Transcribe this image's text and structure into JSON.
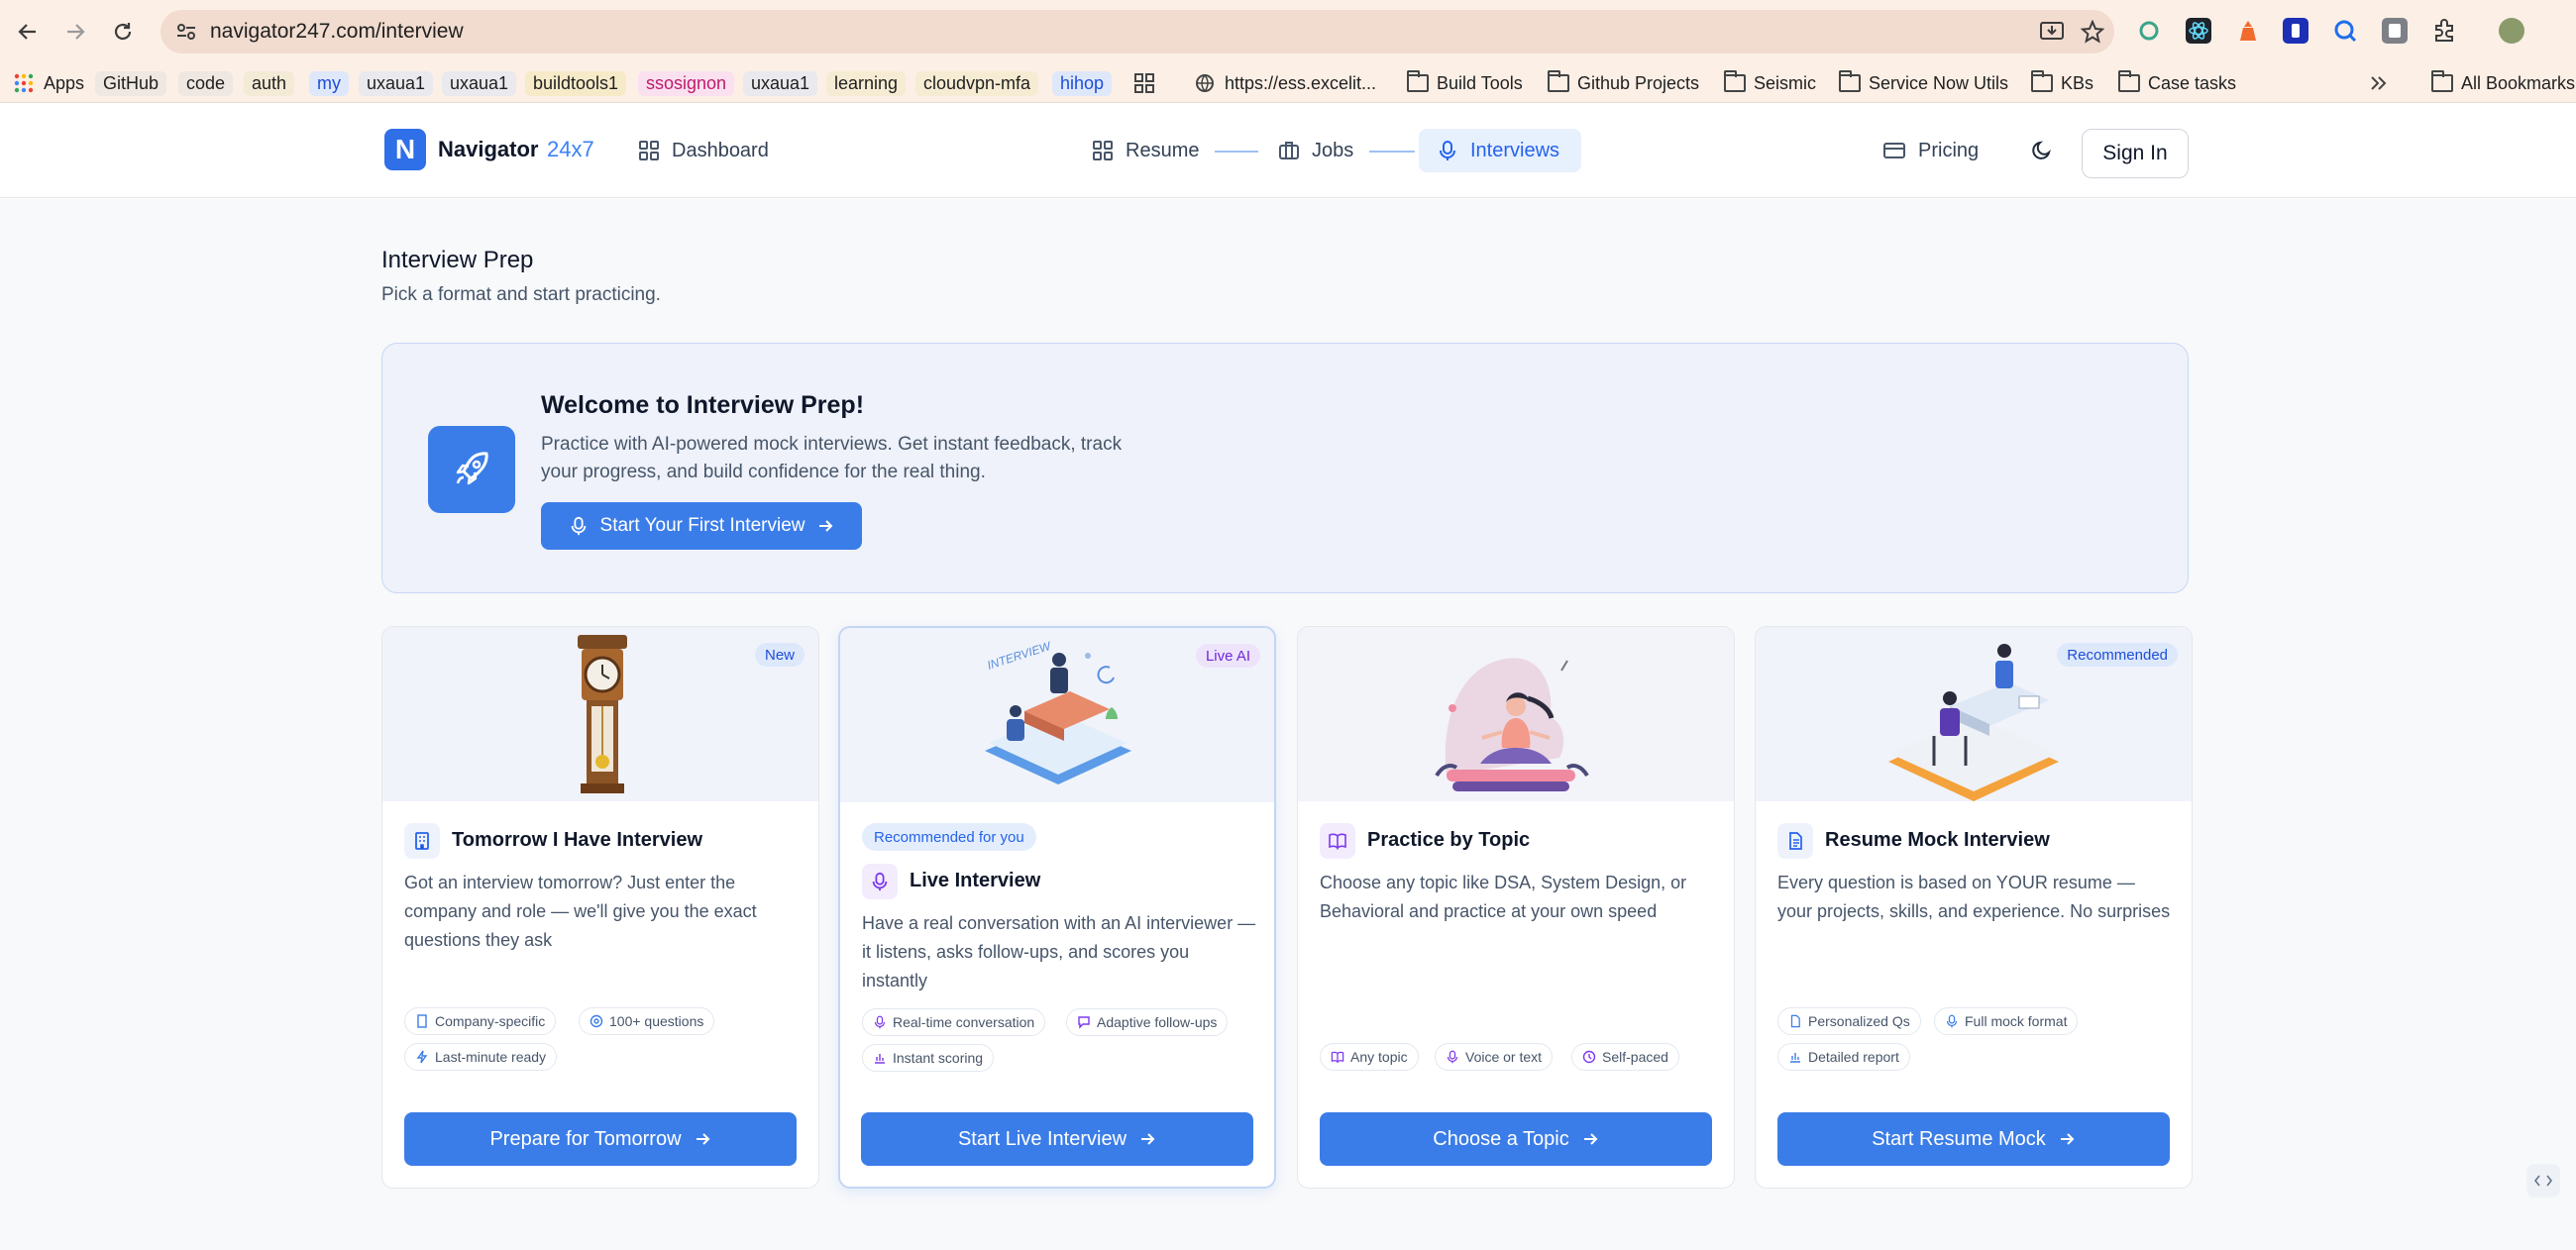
{
  "browser": {
    "url": "navigator247.com/interview",
    "bookmarks": [
      "Apps",
      "GitHub",
      "code",
      "auth",
      "my",
      "uxaua1",
      "uxaua1",
      "buildtools1",
      "ssosignon",
      "uxaua1",
      "learning",
      "cloudvpn-mfa",
      "hihop",
      "https://ess.excelit...",
      "Build Tools",
      "Github Projects",
      "Seismic",
      "Service Now Utils",
      "KBs",
      "Case tasks",
      "All Bookmarks"
    ]
  },
  "header": {
    "logo_letter": "N",
    "logo_name": "Navigator",
    "logo_suffix": "24x7",
    "nav": {
      "dashboard": "Dashboard",
      "resume": "Resume",
      "jobs": "Jobs",
      "interviews": "Interviews",
      "pricing": "Pricing"
    },
    "sign_in": "Sign In"
  },
  "page": {
    "title": "Interview Prep",
    "subtitle": "Pick a format and start practicing."
  },
  "welcome": {
    "title": "Welcome to Interview Prep!",
    "description": "Practice with AI-powered mock interviews. Get instant feedback, track your progress, and build confidence for the real thing.",
    "cta": "Start Your First Interview"
  },
  "cards": [
    {
      "badge": "New",
      "title": "Tomorrow I Have Interview",
      "description": "Got an interview tomorrow? Just enter the company and role — we'll give you the exact questions they ask",
      "tags": [
        "Company-specific",
        "100+ questions",
        "Last-minute ready"
      ],
      "button": "Prepare for Tomorrow"
    },
    {
      "badge": "Live AI",
      "recommended": "Recommended for you",
      "title": "Live Interview",
      "description": "Have a real conversation with an AI interviewer — it listens, asks follow-ups, and scores you instantly",
      "tags": [
        "Real-time conversation",
        "Adaptive follow-ups",
        "Instant scoring"
      ],
      "button": "Start Live Interview",
      "illustration_text": "INTERVIEW"
    },
    {
      "title": "Practice by Topic",
      "description": "Choose any topic like DSA, System Design, or Behavioral and practice at your own speed",
      "tags": [
        "Any topic",
        "Voice or text",
        "Self-paced"
      ],
      "button": "Choose a Topic"
    },
    {
      "badge": "Recommended",
      "title": "Resume Mock Interview",
      "description": "Every question is based on YOUR resume — your projects, skills, and experience. No surprises",
      "tags": [
        "Personalized Qs",
        "Full mock format",
        "Detailed report"
      ],
      "button": "Start Resume Mock"
    }
  ],
  "colors": {
    "accent": "#3b7de8",
    "accent_light": "#e7f0fd",
    "text": "#0f172a",
    "muted": "#475569"
  }
}
